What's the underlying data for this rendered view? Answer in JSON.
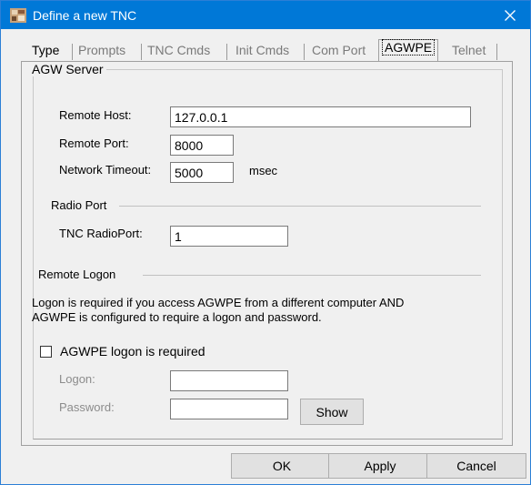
{
  "window": {
    "title": "Define a new TNC"
  },
  "tabs": [
    {
      "label": "Type"
    },
    {
      "label": "Prompts"
    },
    {
      "label": "TNC Cmds"
    },
    {
      "label": "Init Cmds"
    },
    {
      "label": "Com Port"
    },
    {
      "label": "AGWPE"
    },
    {
      "label": "Telnet"
    }
  ],
  "agw_server": {
    "heading": "AGW Server",
    "remote_host_label": "Remote Host:",
    "remote_host_value": "127.0.0.1",
    "remote_port_label": "Remote Port:",
    "remote_port_value": "8000",
    "timeout_label": "Network Timeout:",
    "timeout_value": "5000",
    "timeout_unit": "msec"
  },
  "radio_port": {
    "heading": "Radio Port",
    "label": "TNC RadioPort:",
    "value": "1"
  },
  "remote_logon": {
    "heading": "Remote Logon",
    "info_line1": "Logon is required if you access AGWPE from a different computer AND",
    "info_line2": "AGWPE is configured to require a logon and password.",
    "checkbox_label": "AGWPE logon is required",
    "checkbox_checked": false,
    "logon_label": "Logon:",
    "logon_value": "",
    "password_label": "Password:",
    "password_value": "",
    "show_label": "Show"
  },
  "buttons": {
    "ok": "OK",
    "apply": "Apply",
    "cancel": "Cancel"
  }
}
